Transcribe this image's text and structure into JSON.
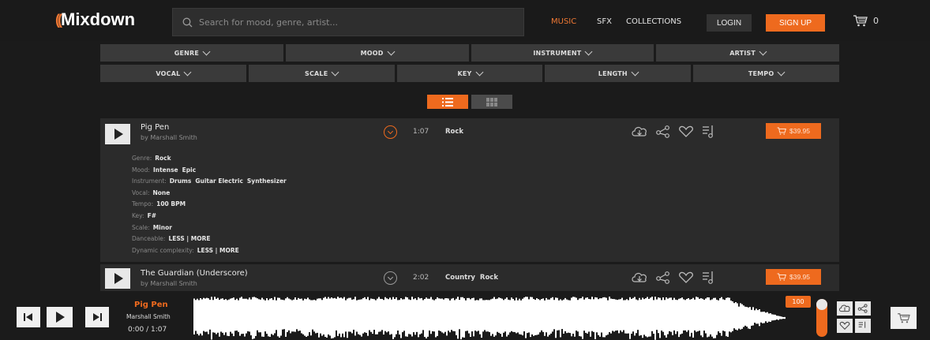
{
  "header": {
    "logo": "Mixdown",
    "search_placeholder": "Search for mood, genre, artist...",
    "nav": {
      "music": "MUSIC",
      "sfx": "SFX",
      "collections": "COLLECTIONS"
    },
    "login": "LOGIN",
    "signup": "SIGN UP",
    "cart_count": "0"
  },
  "filters": {
    "row1": [
      "GENRE",
      "MOOD",
      "INSTRUMENT",
      "ARTIST"
    ],
    "row2": [
      "VOCAL",
      "SCALE",
      "KEY",
      "LENGTH",
      "TEMPO"
    ]
  },
  "tracks": [
    {
      "title": "Pig Pen",
      "by": "by Marshall Smith",
      "duration": "1:07",
      "genre": "Rock",
      "price": "$39.95",
      "details": {
        "genre_label": "Genre:",
        "genre": "Rock",
        "mood_label": "Mood:",
        "mood": [
          "Intense",
          "Epic"
        ],
        "instrument_label": "Instrument:",
        "instruments": [
          "Drums",
          "Guitar Electric",
          "Synthesizer"
        ],
        "vocal_label": "Vocal:",
        "vocal": "None",
        "tempo_label": "Tempo:",
        "tempo": "100 BPM",
        "key_label": "Key:",
        "key": "F#",
        "scale_label": "Scale:",
        "scale": "Minor",
        "danceable_label": "Danceable:",
        "danceable": "LESS | MORE",
        "complexity_label": "Dynamic complexity:",
        "complexity": "LESS | MORE"
      }
    },
    {
      "title": "The Guardian (Underscore)",
      "by": "by Marshall Smith",
      "duration": "2:02",
      "genre": "Country  Rock",
      "price": "$39.95"
    }
  ],
  "player": {
    "title": "Pig Pen",
    "artist": "Marshall Smith",
    "time": "0:00 / 1:07",
    "volume": "100"
  },
  "colors": {
    "accent": "#ee6a1e",
    "background": "#1b1b1b",
    "panel": "#2b2b2b"
  }
}
